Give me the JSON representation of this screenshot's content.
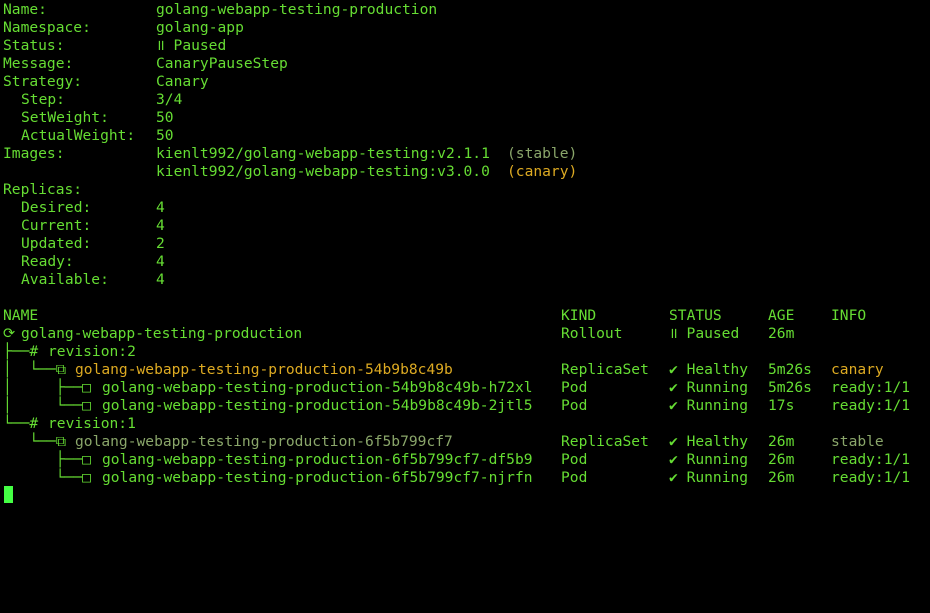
{
  "summary": {
    "name_label": "Name:",
    "name_value": "golang-webapp-testing-production",
    "namespace_label": "Namespace:",
    "namespace_value": "golang-app",
    "status_label": "Status:",
    "status_value": "॥ Paused",
    "message_label": "Message:",
    "message_value": "CanaryPauseStep",
    "strategy_label": "Strategy:",
    "strategy_value": "Canary",
    "step_label": "Step:",
    "step_value": "3/4",
    "setweight_label": "SetWeight:",
    "setweight_value": "50",
    "actualweight_label": "ActualWeight:",
    "actualweight_value": "50",
    "images_label": "Images:",
    "image_stable": "kienlt992/golang-webapp-testing:v2.1.1",
    "image_stable_tag": "(stable)",
    "image_canary": "kienlt992/golang-webapp-testing:v3.0.0",
    "image_canary_tag": "(canary)",
    "replicas_label": "Replicas:",
    "desired_label": "Desired:",
    "desired_value": "4",
    "current_label": "Current:",
    "current_value": "4",
    "updated_label": "Updated:",
    "updated_value": "2",
    "ready_label": "Ready:",
    "ready_value": "4",
    "available_label": "Available:",
    "available_value": "4"
  },
  "table": {
    "headers": {
      "name": "NAME",
      "kind": "KIND",
      "status": "STATUS",
      "age": "AGE",
      "info": "INFO"
    },
    "rows": [
      {
        "prefix": "⟳",
        "name": "golang-webapp-testing-production",
        "kind": "Rollout",
        "status": "॥ Paused",
        "age": "26m",
        "info": ""
      },
      {
        "prefix": "├──# ",
        "name": "revision:2",
        "kind": "",
        "status": "",
        "age": "",
        "info": ""
      },
      {
        "prefix": "│  └──⧉ ",
        "name": "golang-webapp-testing-production-54b9b8c49b",
        "kind": "ReplicaSet",
        "status": "✔ Healthy",
        "age": "5m26s",
        "info": "canary"
      },
      {
        "prefix": "│     ├──□ ",
        "name": "golang-webapp-testing-production-54b9b8c49b-h72xl",
        "kind": "Pod",
        "status": "✔ Running",
        "age": "5m26s",
        "info": "ready:1/1"
      },
      {
        "prefix": "│     └──□ ",
        "name": "golang-webapp-testing-production-54b9b8c49b-2jtl5",
        "kind": "Pod",
        "status": "✔ Running",
        "age": "17s",
        "info": "ready:1/1"
      },
      {
        "prefix": "└──# ",
        "name": "revision:1",
        "kind": "",
        "status": "",
        "age": "",
        "info": ""
      },
      {
        "prefix": "   └──⧉ ",
        "name": "golang-webapp-testing-production-6f5b799cf7",
        "kind": "ReplicaSet",
        "status": "✔ Healthy",
        "age": "26m",
        "info": "stable"
      },
      {
        "prefix": "      ├──□ ",
        "name": "golang-webapp-testing-production-6f5b799cf7-df5b9",
        "kind": "Pod",
        "status": "✔ Running",
        "age": "26m",
        "info": "ready:1/1"
      },
      {
        "prefix": "      └──□ ",
        "name": "golang-webapp-testing-production-6f5b799cf7-njrfn",
        "kind": "Pod",
        "status": "✔ Running",
        "age": "26m",
        "info": "ready:1/1"
      }
    ]
  },
  "colors": {
    "background": "#000000",
    "text": "#66dd33",
    "canary": "#ddaa22",
    "stable_dim": "#8aa66a",
    "cursor": "#44ff44"
  }
}
